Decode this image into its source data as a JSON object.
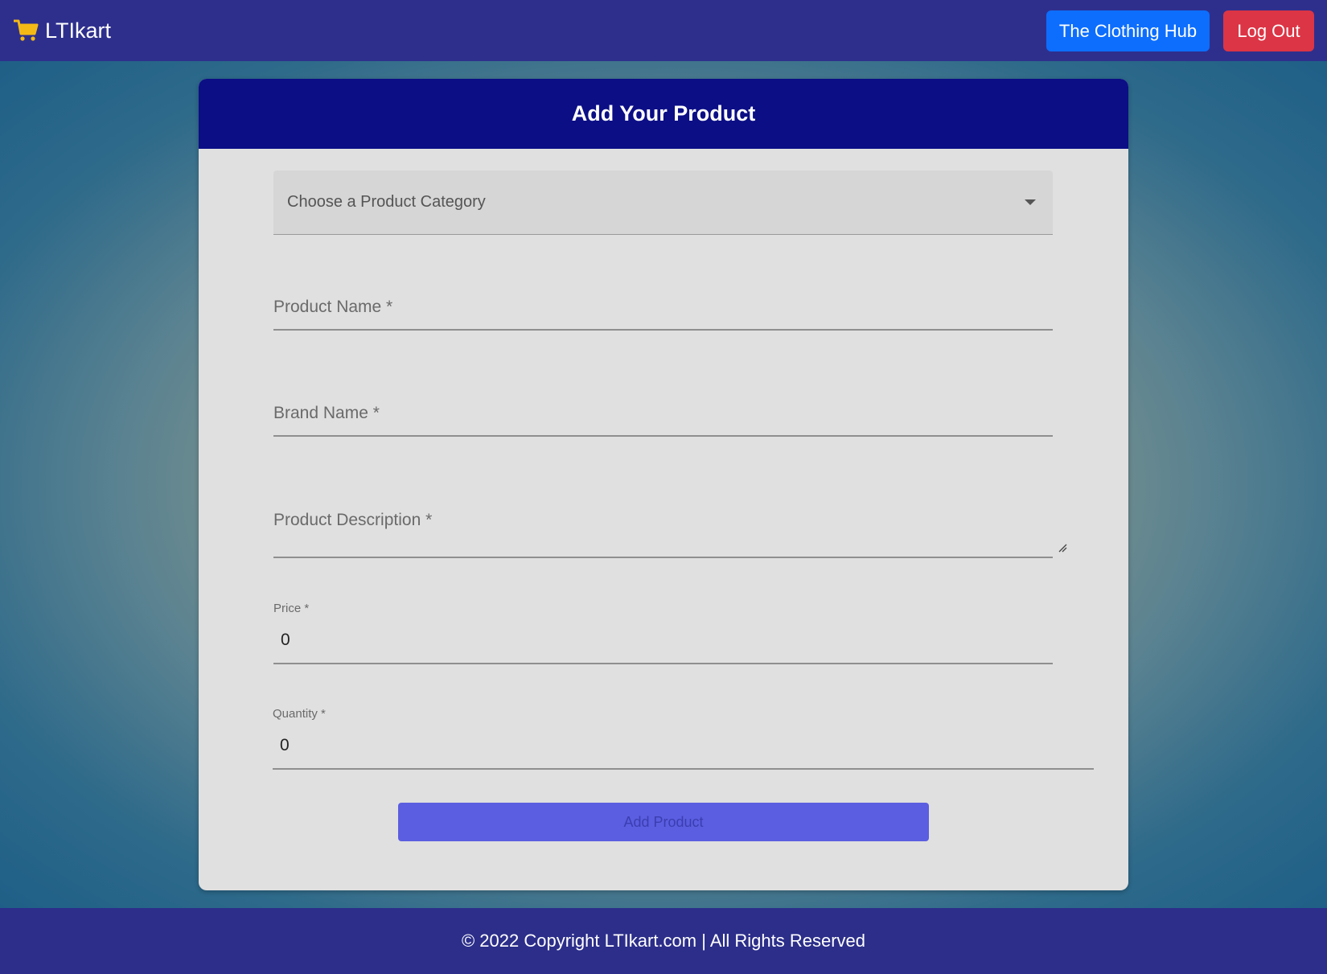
{
  "navbar": {
    "brand": "LTIkart",
    "hub_button": "The Clothing Hub",
    "logout_button": "Log Out"
  },
  "form": {
    "title": "Add Your Product",
    "category_placeholder": "Choose a Product Category",
    "product_name_label": "Product Name *",
    "brand_name_label": "Brand Name *",
    "description_label": "Product Description *",
    "price_label": "Price *",
    "price_value": "0",
    "quantity_label": "Quantity *",
    "quantity_value": "0",
    "submit_button": "Add Product"
  },
  "footer": {
    "copyright": "© 2022 Copyright LTIkart.com | All Rights Reserved"
  },
  "colors": {
    "navbar": "#2e2f8d",
    "card_header": "#0b0e85",
    "hub_button": "#0d6efd",
    "logout_button": "#dc3545",
    "add_button": "#5b5ee0",
    "cart_icon": "#f5b915"
  },
  "icons": {
    "brand": "shopping-cart-icon",
    "dropdown": "chevron-down-icon",
    "textarea_resize": "resize-grip-icon"
  }
}
